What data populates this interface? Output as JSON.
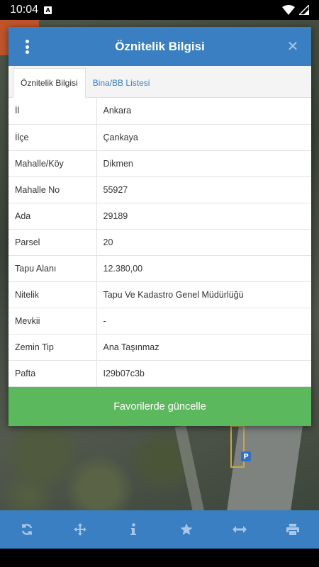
{
  "status_bar": {
    "time": "10:04",
    "notification_badge": "A"
  },
  "dialog": {
    "title": "Öznitelik Bilgisi",
    "close_symbol": "✕",
    "tabs": [
      {
        "label": "Öznitelik Bilgisi",
        "active": true
      },
      {
        "label": "Bina/BB Listesi",
        "active": false
      }
    ],
    "rows": [
      {
        "key": "İl",
        "value": "Ankara"
      },
      {
        "key": "İlçe",
        "value": "Çankaya"
      },
      {
        "key": "Mahalle/Köy",
        "value": "Dikmen"
      },
      {
        "key": "Mahalle No",
        "value": "55927"
      },
      {
        "key": "Ada",
        "value": "29189"
      },
      {
        "key": "Parsel",
        "value": "20"
      },
      {
        "key": "Tapu Alanı",
        "value": "12.380,00"
      },
      {
        "key": "Nitelik",
        "value": "Tapu Ve Kadastro Genel Müdürlüğü"
      },
      {
        "key": "Mevkii",
        "value": "-"
      },
      {
        "key": "Zemin Tip",
        "value": "Ana Taşınmaz"
      },
      {
        "key": "Pafta",
        "value": "I29b07c3b"
      }
    ],
    "update_button": "Favorilerde güncelle"
  },
  "map": {
    "parking_label": "P"
  },
  "toolbar": {
    "icons": [
      "refresh-icon",
      "move-icon",
      "info-icon",
      "star-icon",
      "measure-icon",
      "print-icon"
    ]
  },
  "colors": {
    "header": "#3a7fc1",
    "button": "#5cb85c",
    "toolbar_icon": "#a9c6e8"
  }
}
